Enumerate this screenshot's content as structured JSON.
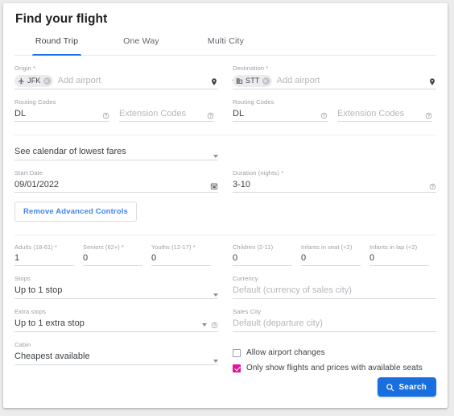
{
  "header": {
    "title": "Find your flight"
  },
  "tabs": [
    {
      "label": "Round Trip",
      "active": true
    },
    {
      "label": "One Way",
      "active": false
    },
    {
      "label": "Multi City",
      "active": false
    }
  ],
  "origin": {
    "label": "Origin *",
    "chip": "JFK",
    "chip_icon": "airplane-icon",
    "placeholder": "Add airport",
    "pin_icon": "map-pin-icon",
    "remove_icon": "chip-remove-icon"
  },
  "destination": {
    "label": "Destination *",
    "chip": "STT",
    "chip_icon": "city-building-icon",
    "placeholder": "Add airport",
    "pin_icon": "map-pin-icon",
    "remove_icon": "chip-remove-icon"
  },
  "swap": {
    "icon": "swap-horizontal-icon"
  },
  "routing": {
    "origin_routing_label": "Routing Codes",
    "origin_routing_value": "DL",
    "origin_extension_placeholder": "Extension Codes",
    "dest_routing_label": "Routing Codes",
    "dest_routing_value": "DL",
    "dest_extension_placeholder": "Extension Codes",
    "help_icon": "help-circle-icon"
  },
  "calendar_select": {
    "value": "See calendar of lowest fares",
    "caret_icon": "chevron-down-icon"
  },
  "start_date": {
    "label": "Start Date",
    "value": "09/01/2022",
    "icon": "calendar-icon"
  },
  "duration": {
    "label": "Duration (nights) *",
    "value": "3-10",
    "help_icon": "help-circle-icon"
  },
  "advanced_controls": {
    "label": "Remove Advanced Controls"
  },
  "passengers": [
    {
      "label": "Adults (18-61) *",
      "value": "1"
    },
    {
      "label": "Seniors (62+) *",
      "value": "0"
    },
    {
      "label": "Youths (12-17) *",
      "value": "0"
    },
    {
      "label": "Children (2-11)",
      "value": "0"
    },
    {
      "label": "Infants in seat (<2)",
      "value": "0"
    },
    {
      "label": "Infants in lap (<2)",
      "value": "0"
    }
  ],
  "stops": {
    "label": "Stops",
    "value": "Up to 1 stop",
    "caret_icon": "chevron-down-icon"
  },
  "currency": {
    "label": "Currency",
    "placeholder": "Default (currency of sales city)"
  },
  "extra_stops": {
    "label": "Extra stops",
    "value": "Up to 1 extra stop",
    "caret_icon": "chevron-down-icon",
    "help_icon": "help-circle-icon"
  },
  "sales_city": {
    "label": "Sales City",
    "placeholder": "Default (departure city)"
  },
  "cabin": {
    "label": "Cabin",
    "value": "Cheapest available",
    "caret_icon": "chevron-down-icon"
  },
  "checkboxes": [
    {
      "label": "Allow airport changes",
      "checked": false
    },
    {
      "label": "Only show flights and prices with available seats",
      "checked": true
    }
  ],
  "search_button": {
    "label": "Search",
    "icon": "search-icon"
  },
  "colors": {
    "accent_blue": "#1a73e8",
    "button_blue": "#1a6fe0",
    "checkbox_magenta": "#e5129b",
    "link_blue": "#4285f4",
    "label_gray": "#9aa0a6",
    "text_gray": "#3c4043"
  }
}
